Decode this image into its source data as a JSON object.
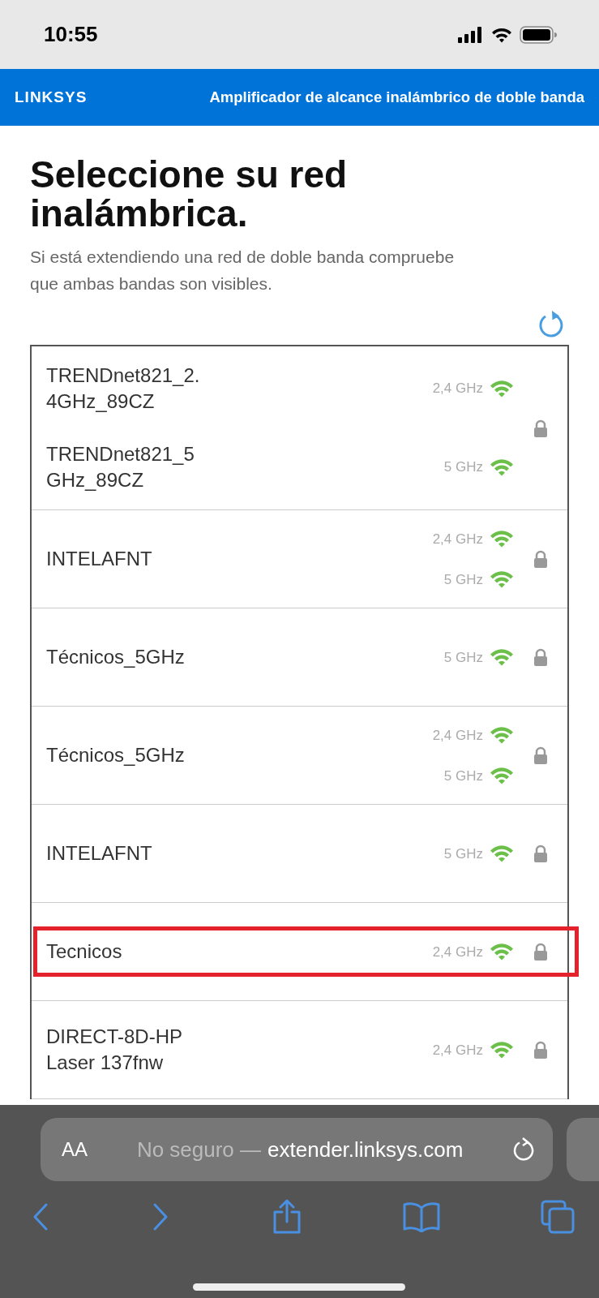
{
  "status_bar": {
    "time": "10:55"
  },
  "header": {
    "logo": "LINKSYS",
    "title": "Amplificador de alcance inalámbrico de doble banda"
  },
  "heading": "Seleccione su red inalámbrica.",
  "subtitle": "Si está extendiendo una red de doble banda compruebe que ambas bandas son visibles.",
  "networks": [
    {
      "locked": true,
      "highlighted": false,
      "entries": [
        {
          "name": "TRENDnet821_2.\n4GHz_89CZ",
          "bands": [
            "2,4 GHz"
          ]
        },
        {
          "name": "TRENDnet821_5\nGHz_89CZ",
          "bands": [
            "5 GHz"
          ]
        }
      ]
    },
    {
      "locked": true,
      "highlighted": false,
      "entries": [
        {
          "name": "INTELAFNT",
          "bands": [
            "2,4 GHz",
            "5 GHz"
          ]
        }
      ]
    },
    {
      "locked": true,
      "highlighted": false,
      "entries": [
        {
          "name": "Técnicos_5GHz",
          "bands": [
            "5 GHz"
          ]
        }
      ]
    },
    {
      "locked": true,
      "highlighted": false,
      "entries": [
        {
          "name": "Técnicos_5GHz",
          "bands": [
            "2,4 GHz",
            "5 GHz"
          ]
        }
      ]
    },
    {
      "locked": true,
      "highlighted": false,
      "entries": [
        {
          "name": "INTELAFNT",
          "bands": [
            "5 GHz"
          ]
        }
      ]
    },
    {
      "locked": true,
      "highlighted": true,
      "entries": [
        {
          "name": "Tecnicos",
          "bands": [
            "2,4 GHz"
          ]
        }
      ]
    },
    {
      "locked": true,
      "highlighted": false,
      "entries": [
        {
          "name": "DIRECT-8D-HP\nLaser 137fnw",
          "bands": [
            "2,4 GHz"
          ]
        }
      ]
    }
  ],
  "browser": {
    "text_size": "AA",
    "security": "No seguro —",
    "url": "extender.linksys.com"
  }
}
